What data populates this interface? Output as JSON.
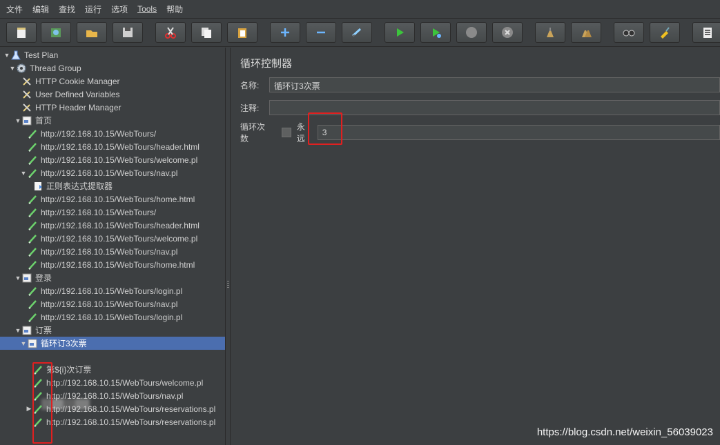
{
  "menu": [
    "文件",
    "编辑",
    "查找",
    "运行",
    "选项",
    "Tools",
    "帮助"
  ],
  "toolbar": [
    "new-icon",
    "templates-icon",
    "open-icon",
    "save-icon",
    "cut-icon",
    "copy-icon",
    "paste-icon",
    "expand-icon",
    "collapse-icon",
    "toggle-icon",
    "start-icon",
    "start-no-pause-icon",
    "stop-icon",
    "shutdown-icon",
    "clear-icon",
    "clear-all-icon",
    "search-icon",
    "reset-search-icon",
    "function-helper-icon"
  ],
  "tree": [
    {
      "label": "Test Plan",
      "icon": "flask-icon",
      "indent": 0,
      "arrow": "▼"
    },
    {
      "label": "Thread Group",
      "icon": "gear-icon",
      "indent": 1,
      "arrow": "▼"
    },
    {
      "label": "HTTP Cookie Manager",
      "icon": "wrench-icon",
      "indent": 2,
      "arrow": ""
    },
    {
      "label": "User Defined Variables",
      "icon": "wrench-icon",
      "indent": 2,
      "arrow": ""
    },
    {
      "label": "HTTP Header Manager",
      "icon": "wrench-icon",
      "indent": 2,
      "arrow": ""
    },
    {
      "label": "首页",
      "icon": "controller-icon",
      "indent": 2,
      "arrow": "▼"
    },
    {
      "label": "http://192.168.10.15/WebTours/",
      "icon": "sampler-icon",
      "indent": 3,
      "arrow": ""
    },
    {
      "label": "http://192.168.10.15/WebTours/header.html",
      "icon": "sampler-icon",
      "indent": 3,
      "arrow": ""
    },
    {
      "label": "http://192.168.10.15/WebTours/welcome.pl",
      "icon": "sampler-icon",
      "indent": 3,
      "arrow": ""
    },
    {
      "label": "http://192.168.10.15/WebTours/nav.pl",
      "icon": "sampler-icon",
      "indent": 3,
      "arrow": "▼"
    },
    {
      "label": "正则表达式提取器",
      "icon": "extractor-icon",
      "indent": 4,
      "arrow": ""
    },
    {
      "label": "http://192.168.10.15/WebTours/home.html",
      "icon": "sampler-icon",
      "indent": 3,
      "arrow": ""
    },
    {
      "label": "http://192.168.10.15/WebTours/",
      "icon": "sampler-icon",
      "indent": 3,
      "arrow": ""
    },
    {
      "label": "http://192.168.10.15/WebTours/header.html",
      "icon": "sampler-icon",
      "indent": 3,
      "arrow": ""
    },
    {
      "label": "http://192.168.10.15/WebTours/welcome.pl",
      "icon": "sampler-icon",
      "indent": 3,
      "arrow": ""
    },
    {
      "label": "http://192.168.10.15/WebTours/nav.pl",
      "icon": "sampler-icon",
      "indent": 3,
      "arrow": ""
    },
    {
      "label": "http://192.168.10.15/WebTours/home.html",
      "icon": "sampler-icon",
      "indent": 3,
      "arrow": ""
    },
    {
      "label": "登录",
      "icon": "controller-icon",
      "indent": 2,
      "arrow": "▼"
    },
    {
      "label": "http://192.168.10.15/WebTours/login.pl",
      "icon": "sampler-icon",
      "indent": 3,
      "arrow": ""
    },
    {
      "label": "http://192.168.10.15/WebTours/nav.pl",
      "icon": "sampler-icon",
      "indent": 3,
      "arrow": ""
    },
    {
      "label": "http://192.168.10.15/WebTours/login.pl",
      "icon": "sampler-icon",
      "indent": 3,
      "arrow": ""
    },
    {
      "label": "订票",
      "icon": "controller-icon",
      "indent": 2,
      "arrow": "▼"
    },
    {
      "label": "循环订3次票",
      "icon": "controller-icon",
      "indent": 3,
      "arrow": "▼",
      "selected": true
    },
    {
      "label": "",
      "icon": "",
      "indent": 4,
      "arrow": ""
    },
    {
      "label": "第${i}次订票",
      "icon": "sampler-icon",
      "indent": 4,
      "arrow": ""
    },
    {
      "label": "http://192.168.10.15/WebTours/welcome.pl",
      "icon": "sampler-icon",
      "indent": 4,
      "arrow": ""
    },
    {
      "label": "http://192.168.10.15/WebTours/nav.pl",
      "icon": "sampler-icon",
      "indent": 4,
      "arrow": ""
    },
    {
      "label": "http://192.168.10.15/WebTours/reservations.pl",
      "icon": "sampler-icon",
      "indent": 4,
      "arrow": "▶"
    },
    {
      "label": "http://192.168.10.15/WebTours/reservations.pl",
      "icon": "sampler-icon",
      "indent": 4,
      "arrow": ""
    }
  ],
  "panel": {
    "title": "循环控制器",
    "name_label": "名称:",
    "name_value": "循环订3次票",
    "comment_label": "注释:",
    "comment_value": "",
    "loop_label": "循环次数",
    "forever_label": "永远",
    "loop_value": "3"
  },
  "watermark": "https://blog.csdn.net/weixin_56039023"
}
